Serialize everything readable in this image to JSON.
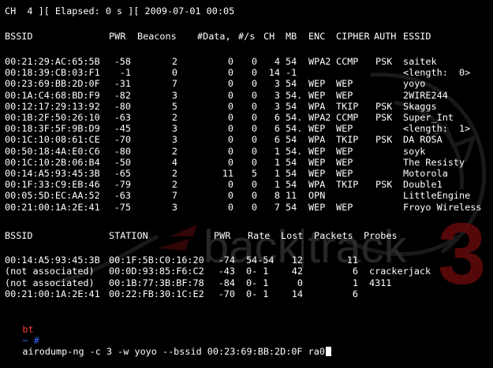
{
  "status": {
    "channel": "CH  4 ][ Elapsed: 0 s ][ 2009-07-01 00:05"
  },
  "ap_table": {
    "headers": {
      "bssid": "BSSID",
      "pwr": "PWR",
      "beacons": "Beacons",
      "data": "#Data,",
      "per_s": "#/s",
      "ch": "CH",
      "mb": "MB",
      "enc": "ENC",
      "cipher": "CIPHER",
      "auth": "AUTH",
      "essid": "ESSID"
    },
    "rows": [
      {
        "bssid": "00:21:29:AC:65:5B",
        "pwr": "-58",
        "beacons": "2",
        "data": "0",
        "per_s": "0",
        "ch": "4",
        "mb": "54",
        "enc": "WPA2",
        "cipher": "CCMP",
        "auth": "PSK",
        "essid": "saitek"
      },
      {
        "bssid": "00:18:39:CB:03:F1",
        "pwr": "-1",
        "beacons": "0",
        "data": "0",
        "per_s": "0",
        "ch": "14",
        "mb": "-1",
        "enc": "",
        "cipher": "",
        "auth": "",
        "essid": "<length:  0>"
      },
      {
        "bssid": "00:23:69:BB:2D:0F",
        "pwr": "-31",
        "beacons": "7",
        "data": "0",
        "per_s": "0",
        "ch": "3",
        "mb": "54",
        "enc": "WEP",
        "cipher": "WEP",
        "auth": "",
        "essid": "yoyo"
      },
      {
        "bssid": "00:1A:C4:68:BD:F9",
        "pwr": "-82",
        "beacons": "3",
        "data": "0",
        "per_s": "0",
        "ch": "3",
        "mb": "54.",
        "enc": "WEP",
        "cipher": "WEP",
        "auth": "",
        "essid": "2WIRE244"
      },
      {
        "bssid": "00:12:17:29:13:92",
        "pwr": "-80",
        "beacons": "5",
        "data": "0",
        "per_s": "0",
        "ch": "3",
        "mb": "54",
        "enc": "WPA",
        "cipher": "TKIP",
        "auth": "PSK",
        "essid": "Skaggs"
      },
      {
        "bssid": "00:1B:2F:50:26:10",
        "pwr": "-63",
        "beacons": "2",
        "data": "0",
        "per_s": "0",
        "ch": "6",
        "mb": "54.",
        "enc": "WPA2",
        "cipher": "CCMP",
        "auth": "PSK",
        "essid": "Super_Int"
      },
      {
        "bssid": "00:18:3F:5F:9B:D9",
        "pwr": "-45",
        "beacons": "3",
        "data": "0",
        "per_s": "0",
        "ch": "6",
        "mb": "54.",
        "enc": "WEP",
        "cipher": "WEP",
        "auth": "",
        "essid": "<length:  1>"
      },
      {
        "bssid": "00:1C:10:08:61:CE",
        "pwr": "-70",
        "beacons": "3",
        "data": "0",
        "per_s": "0",
        "ch": "6",
        "mb": "54",
        "enc": "WPA",
        "cipher": "TKIP",
        "auth": "PSK",
        "essid": "DA ROSA"
      },
      {
        "bssid": "00:50:18:4A:E0:C6",
        "pwr": "-80",
        "beacons": "2",
        "data": "0",
        "per_s": "0",
        "ch": "1",
        "mb": "54.",
        "enc": "WEP",
        "cipher": "WEP",
        "auth": "",
        "essid": "soyk"
      },
      {
        "bssid": "00:1C:10:2B:06:B4",
        "pwr": "-50",
        "beacons": "4",
        "data": "0",
        "per_s": "0",
        "ch": "1",
        "mb": "54",
        "enc": "WEP",
        "cipher": "WEP",
        "auth": "",
        "essid": "The Resisty"
      },
      {
        "bssid": "00:14:A5:93:45:3B",
        "pwr": "-65",
        "beacons": "2",
        "data": "11",
        "per_s": "5",
        "ch": "1",
        "mb": "54",
        "enc": "WEP",
        "cipher": "WEP",
        "auth": "",
        "essid": "Motorola"
      },
      {
        "bssid": "00:1F:33:C9:EB:46",
        "pwr": "-79",
        "beacons": "2",
        "data": "0",
        "per_s": "0",
        "ch": "1",
        "mb": "54",
        "enc": "WPA",
        "cipher": "TKIP",
        "auth": "PSK",
        "essid": "Double1"
      },
      {
        "bssid": "00:05:5D:EC:AA:52",
        "pwr": "-63",
        "beacons": "7",
        "data": "0",
        "per_s": "0",
        "ch": "8",
        "mb": "11",
        "enc": "OPN",
        "cipher": "",
        "auth": "",
        "essid": "LittleEngine"
      },
      {
        "bssid": "00:21:00:1A:2E:41",
        "pwr": "-75",
        "beacons": "3",
        "data": "0",
        "per_s": "0",
        "ch": "7",
        "mb": "54",
        "enc": "WEP",
        "cipher": "WEP",
        "auth": "",
        "essid": "Froyo Wireless"
      }
    ]
  },
  "station_table": {
    "headers": {
      "bssid": "BSSID",
      "station": "STATION",
      "pwr": "PWR",
      "rate": "Rate",
      "lost": "Lost",
      "packets": "Packets",
      "probes": "Probes"
    },
    "rows": [
      {
        "bssid": "00:14:A5:93:45:3B",
        "station": "00:1F:5B:C0:16:20",
        "pwr": "-74",
        "rate": "54-54",
        "lost": "12",
        "packets": "11",
        "probes": ""
      },
      {
        "bssid": "(not associated)",
        "station": "00:0D:93:85:F6:C2",
        "pwr": "-43",
        "rate": "0- 1",
        "lost": "42",
        "packets": "6",
        "probes": "crackerjack"
      },
      {
        "bssid": "(not associated)",
        "station": "00:1B:77:3B:BF:78",
        "pwr": "-84",
        "rate": "0- 1",
        "lost": "0",
        "packets": "1",
        "probes": "4311"
      },
      {
        "bssid": "00:21:00:1A:2E:41",
        "station": "00:22:FB:30:1C:E2",
        "pwr": "-70",
        "rate": "0- 1",
        "lost": "14",
        "packets": "6",
        "probes": ""
      }
    ]
  },
  "prompt": {
    "host": "bt",
    "path": "~ #",
    "command": "airodump-ng -c 3 -w yoyo --bssid 00:23:69:BB:2D:0F ra0"
  },
  "watermark": {
    "left": "back",
    "right": "track",
    "number": "3"
  },
  "colors": {
    "background": "#000000",
    "text": "#ffffff",
    "prompt_host": "#ff3b3b",
    "prompt_path": "#2f6bff",
    "watermark_text": "#3a3a3a",
    "watermark_number": "#6b0b0b"
  }
}
